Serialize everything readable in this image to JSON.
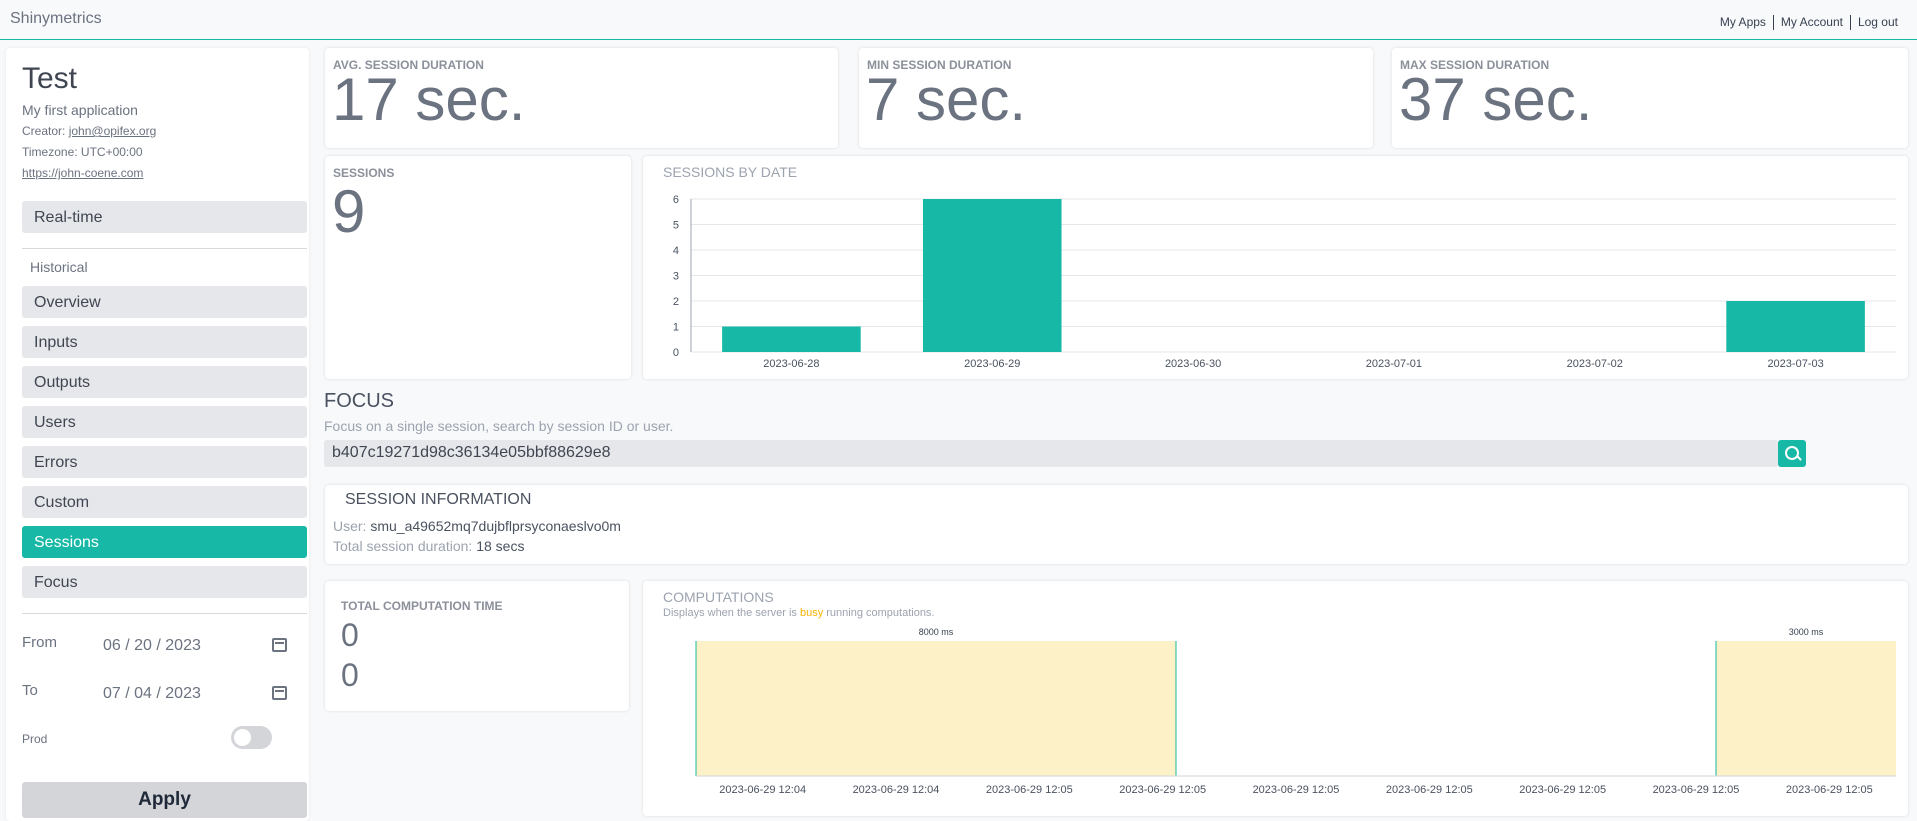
{
  "topbar": {
    "brand": "Shinymetrics",
    "links": [
      "My Apps",
      "My Account",
      "Log out"
    ]
  },
  "sidebar": {
    "title": "Test",
    "description": "My first application",
    "creator_label": "Creator:",
    "creator_email": "john@opifex.org",
    "timezone": "Timezone: UTC+00:00",
    "url": "https://john-coene.com",
    "realtime": "Real-time",
    "historical_label": "Historical",
    "nav": [
      "Overview",
      "Inputs",
      "Outputs",
      "Users",
      "Errors",
      "Custom",
      "Sessions",
      "Focus"
    ],
    "active_nav": "Sessions",
    "from_label": "From",
    "from_value": "06 / 20 / 2023",
    "to_label": "To",
    "to_value": "07 / 04 / 2023",
    "prod_label": "Prod",
    "prod_on": false,
    "apply": "Apply"
  },
  "stats": {
    "avg_label": "AVG. SESSION DURATION",
    "avg_value": "17 sec.",
    "min_label": "MIN SESSION DURATION",
    "min_value": "7 sec.",
    "max_label": "MAX SESSION DURATION",
    "max_value": "37 sec.",
    "sessions_label": "SESSIONS",
    "sessions_value": "9"
  },
  "chart_data": [
    {
      "type": "bar",
      "title": "SESSIONS BY DATE",
      "categories": [
        "2023-06-28",
        "2023-06-29",
        "2023-06-30",
        "2023-07-01",
        "2023-07-02",
        "2023-07-03"
      ],
      "values": [
        1,
        6,
        0,
        0,
        0,
        2
      ],
      "yticks": [
        0,
        1,
        2,
        3,
        4,
        5,
        6
      ],
      "ylim": [
        0,
        6
      ],
      "color": "#17b8a6",
      "grid": true
    },
    {
      "type": "area",
      "title": "COMPUTATIONS",
      "subtitle_pre": "Displays when the server is ",
      "subtitle_highlight": "busy",
      "subtitle_post": " running computations.",
      "x_ticks": [
        "2023-06-29 12:04",
        "2023-06-29 12:04",
        "2023-06-29 12:05",
        "2023-06-29 12:05",
        "2023-06-29 12:05",
        "2023-06-29 12:05",
        "2023-06-29 12:05",
        "2023-06-29 12:05",
        "2023-06-29 12:05"
      ],
      "spans": [
        {
          "label": "8000 ms",
          "duration_ms": 8000
        },
        {
          "label": "3000 ms",
          "duration_ms": 3000
        }
      ],
      "fill_color": "#fdf1c7",
      "edge_color": "#17b8a6"
    }
  ],
  "focus": {
    "title": "FOCUS",
    "subtitle": "Focus on a single session, search by session ID or user.",
    "search_value": "b407c19271d98c36134e05bbf88629e8"
  },
  "session_info": {
    "title": "SESSION INFORMATION",
    "user_label": "User:",
    "user_value": "smu_a49652mq7dujbflprsyconaeslvo0m",
    "duration_label": "Total session duration:",
    "duration_value": "18 secs"
  },
  "computation": {
    "label": "TOTAL COMPUTATION TIME",
    "values": [
      "0",
      "0"
    ]
  }
}
